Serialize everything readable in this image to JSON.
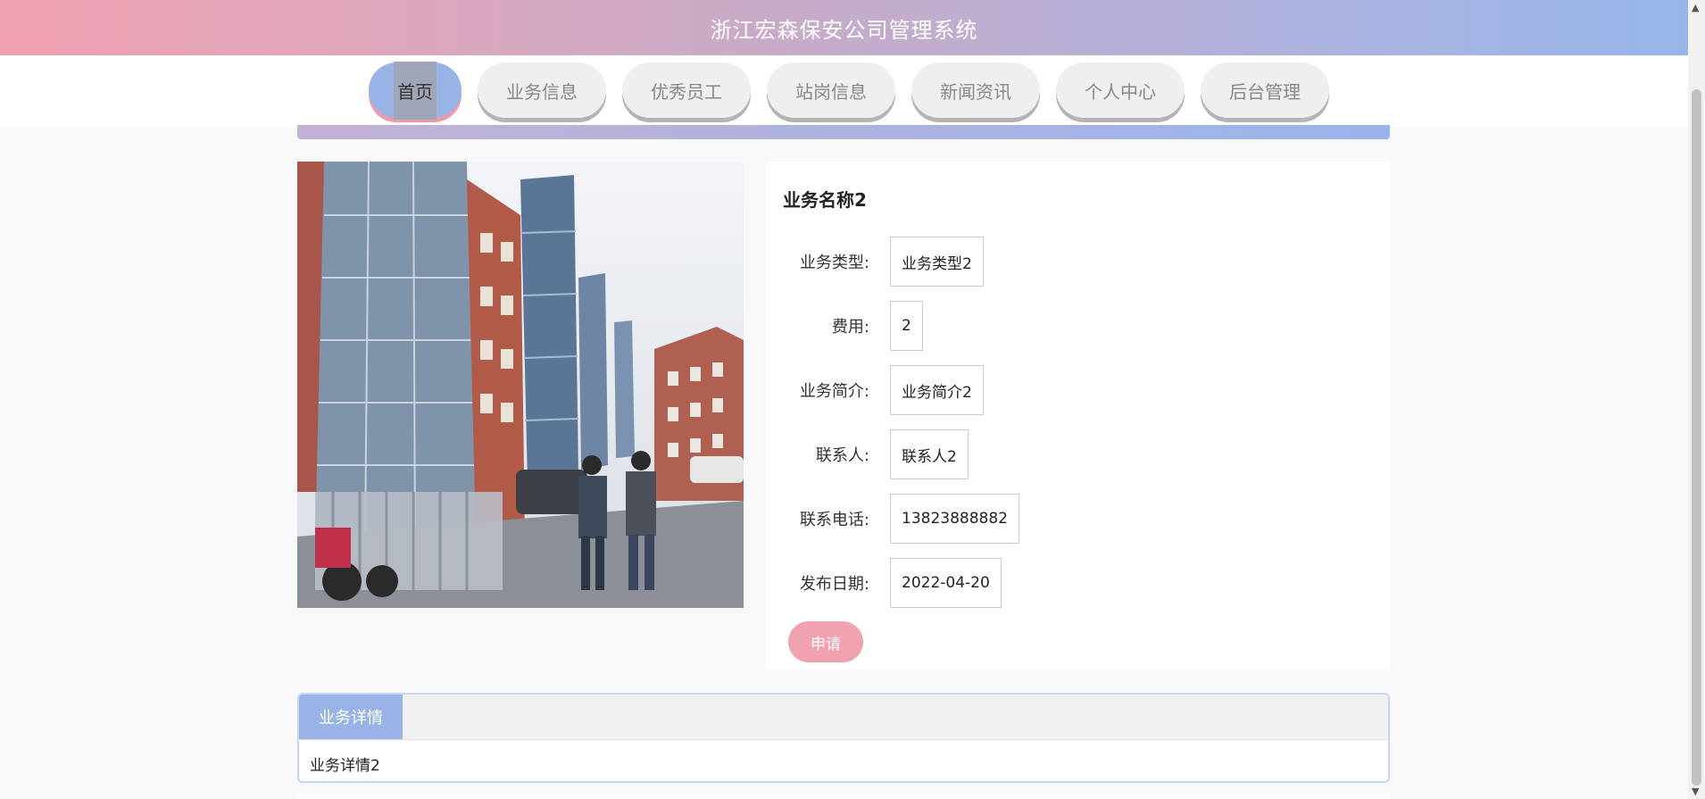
{
  "header": {
    "title": "浙江宏森保安公司管理系统"
  },
  "nav": {
    "items": [
      {
        "label": "首页",
        "active": true
      },
      {
        "label": "业务信息",
        "active": false
      },
      {
        "label": "优秀员工",
        "active": false
      },
      {
        "label": "站岗信息",
        "active": false
      },
      {
        "label": "新闻资讯",
        "active": false
      },
      {
        "label": "个人中心",
        "active": false
      },
      {
        "label": "后台管理",
        "active": false
      }
    ]
  },
  "business": {
    "name": "业务名称2",
    "fields": [
      {
        "label": "业务类型:",
        "value": "业务类型2"
      },
      {
        "label": "费用:",
        "value": "2"
      },
      {
        "label": "业务简介:",
        "value": "业务简介2"
      },
      {
        "label": "联系人:",
        "value": "联系人2"
      },
      {
        "label": "联系电话:",
        "value": "13823888882"
      },
      {
        "label": "发布日期:",
        "value": "2022-04-20"
      }
    ],
    "apply_label": "申请"
  },
  "details": {
    "tab_label": "业务详情",
    "content": "业务详情2"
  },
  "colors": {
    "accent_blue": "#98b3e6",
    "accent_pink": "#f0a2b1"
  }
}
